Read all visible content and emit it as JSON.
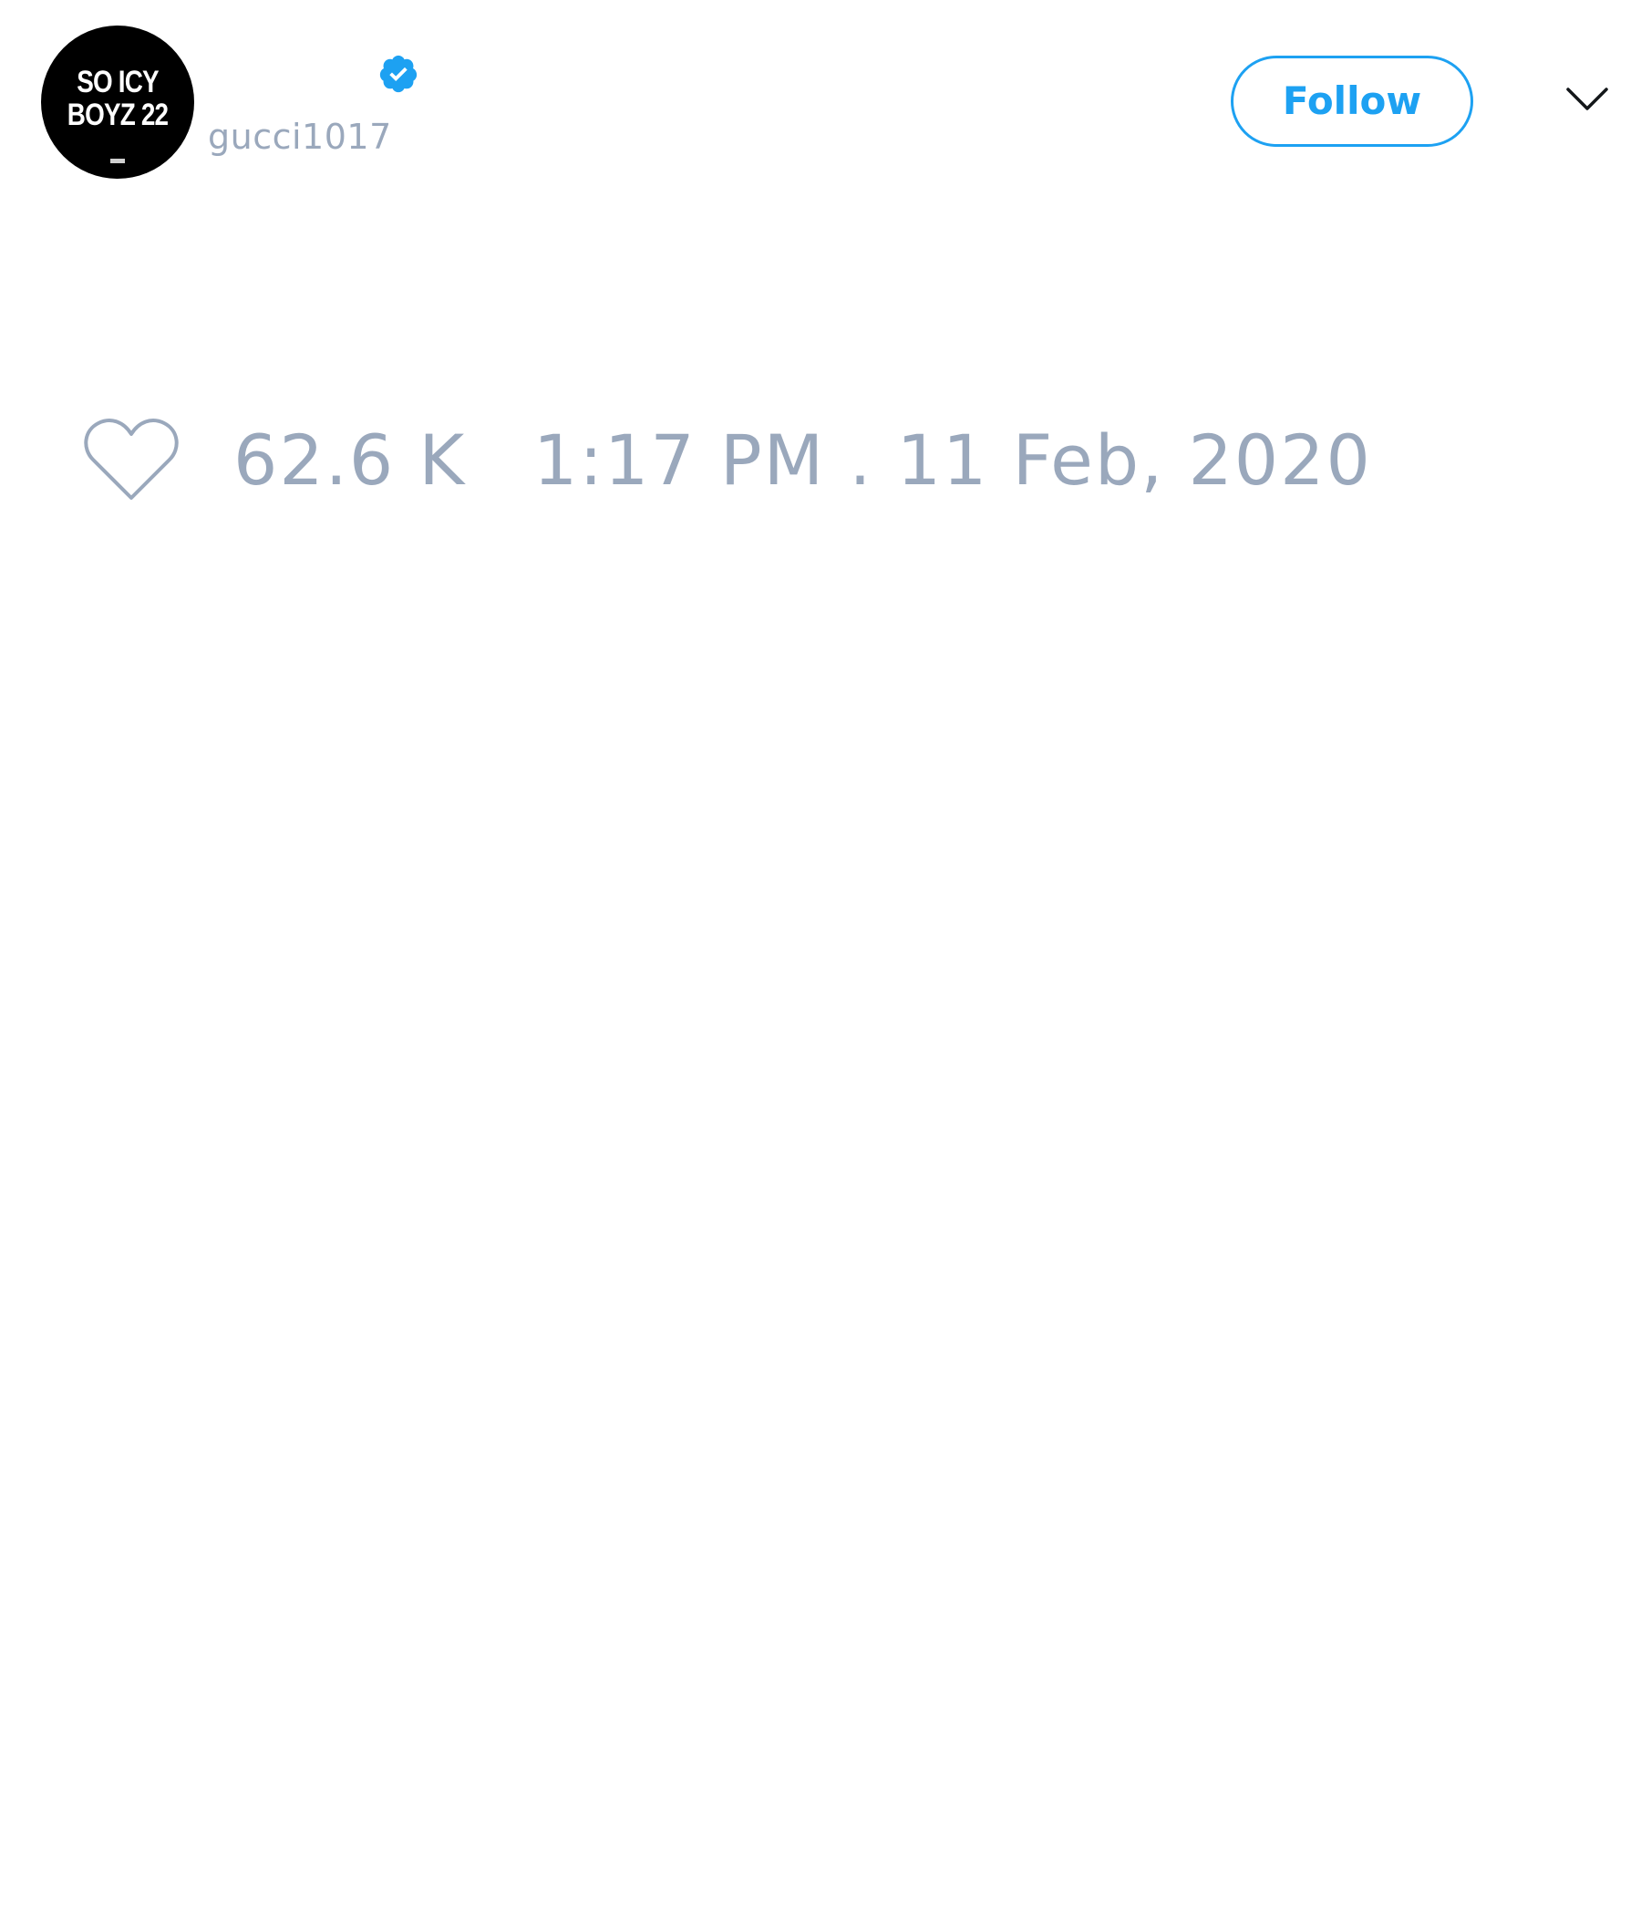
{
  "author": {
    "display_name": "",
    "handle": "gucci1017",
    "verified": true,
    "avatar_text": "SO ICY\nBOYZ 22"
  },
  "actions": {
    "follow_label": "Follow",
    "menu_icon": "chevron-down-icon"
  },
  "engagement": {
    "like_icon": "heart-icon",
    "like_count": "62.6 K",
    "timestamp": "1:17 PM . 11 Feb, 2020"
  },
  "colors": {
    "accent": "#1da1f2",
    "muted_text": "#9aa8bc",
    "avatar_bg": "#000000"
  }
}
